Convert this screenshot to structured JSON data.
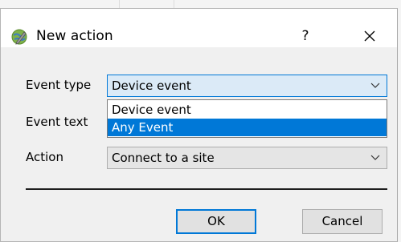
{
  "dialog": {
    "title": "New action",
    "help_label": "?",
    "colors": {
      "accent": "#0078d7",
      "titlebar": "#ffffff",
      "body": "#f0f0f0"
    }
  },
  "form": {
    "event_type": {
      "label": "Event type",
      "value": "Device event",
      "options": [
        "Device event",
        "Any Event"
      ],
      "highlighted_option": "Any Event"
    },
    "event_text": {
      "label": "Event text"
    },
    "action": {
      "label": "Action",
      "value": "Connect to a site"
    }
  },
  "buttons": {
    "ok_label": "OK",
    "cancel_label": "Cancel"
  },
  "icons": {
    "app": "globe-pencil-icon",
    "close": "close-icon",
    "dropdown": "chevron-down-icon"
  }
}
